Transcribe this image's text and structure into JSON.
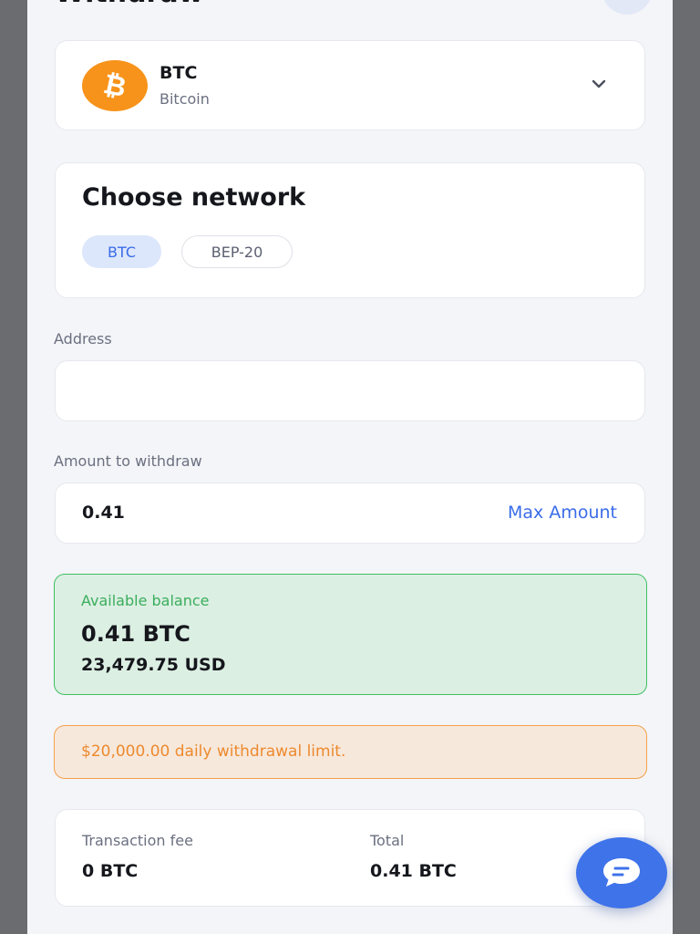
{
  "header": {
    "title": "Withdraw"
  },
  "coin": {
    "symbol": "BTC",
    "name": "Bitcoin",
    "icon": "bitcoin-icon",
    "color": "#f7931a"
  },
  "network": {
    "title": "Choose network",
    "options": [
      "BTC",
      "BEP-20"
    ],
    "selected": "BTC"
  },
  "address": {
    "label": "Address",
    "value": ""
  },
  "amount": {
    "label": "Amount to withdraw",
    "value": "0.41",
    "max_label": "Max Amount"
  },
  "balance": {
    "label": "Available balance",
    "btc": "0.41 BTC",
    "usd": "23,479.75 USD"
  },
  "limit": {
    "text": "$20,000.00 daily withdrawal limit."
  },
  "summary": {
    "fee_label": "Transaction fee",
    "fee_value": "0 BTC",
    "total_label": "Total",
    "total_value": "0.41 BTC"
  },
  "chat": {
    "icon": "chat-icon"
  },
  "colors": {
    "accent": "#3a6ce8",
    "success": "#3fbf63",
    "warning": "#f5a04a",
    "bitcoin": "#f7931a"
  }
}
